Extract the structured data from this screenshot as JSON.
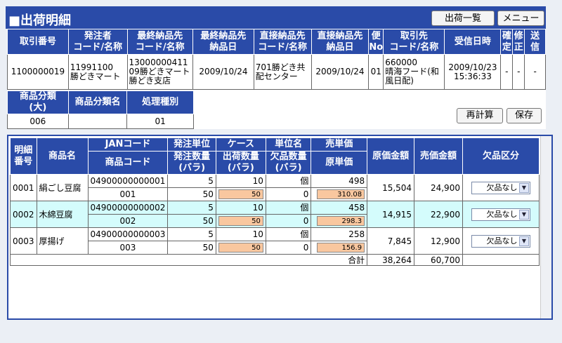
{
  "header": {
    "title": "■出荷明細",
    "buttons": {
      "shipment_list": "出荷一覧",
      "menu": "メニュー"
    }
  },
  "order_table": {
    "headers": [
      [
        "取引番号"
      ],
      [
        "発注者",
        "コード/名称"
      ],
      [
        "最終納品先",
        "コード/名称"
      ],
      [
        "最終納品先",
        "納品日"
      ],
      [
        "直接納品先",
        "コード/名称"
      ],
      [
        "直接納品先",
        "納品日"
      ],
      [
        "便",
        "No"
      ],
      [
        "取引先",
        "コード/名称"
      ],
      [
        "受信日時"
      ],
      [
        "確",
        "定"
      ],
      [
        "修",
        "正"
      ],
      [
        "送",
        "信"
      ]
    ],
    "row": {
      "transaction_no": "1100000019",
      "orderer_code": "11991100",
      "orderer_name": "勝どきマート",
      "final_dest": "1300000041109勝どきマート勝どき支店",
      "final_date": "2009/10/24",
      "direct_dest": "701勝どき共配センター",
      "direct_date": "2009/10/24",
      "bin_no": "01",
      "supplier_code": "660000",
      "supplier_name": "晴海フード(和風日配)",
      "received_date": "2009/10/23",
      "received_time": "15:36:33",
      "confirmed": "-",
      "modified": "-",
      "sent": "-"
    }
  },
  "category_table": {
    "headers": {
      "major": [
        "商品分類",
        "(大)"
      ],
      "name": "商品分類名",
      "process": "処理種別"
    },
    "values": {
      "major": "006",
      "name": "",
      "process": "01"
    }
  },
  "actions": {
    "recalc": "再計算",
    "save": "保存"
  },
  "detail_table": {
    "headers": {
      "line_no": [
        "明細",
        "番号"
      ],
      "product_name": "商品名",
      "jan": "JANコード",
      "product_code": "商品コード",
      "order_unit": "発注単位",
      "order_qty": [
        "発注数量",
        "(バラ)"
      ],
      "case": "ケース",
      "ship_qty": [
        "出荷数量",
        "(バラ)"
      ],
      "unit_name": "単位名",
      "short_qty": [
        "欠品数量",
        "(バラ)"
      ],
      "selling_price": "売単価",
      "cost_price": "原単価",
      "cost_amount": "原価金額",
      "sales_amount": "売価金額",
      "shortage_type": "欠品区分"
    },
    "rows": [
      {
        "line_no": "0001",
        "name": "絹ごし豆腐",
        "jan": "04900000000001",
        "code": "001",
        "order_unit": "5",
        "order_qty": "50",
        "case": "10",
        "ship_qty": "50",
        "unit_name": "個",
        "short_qty": "0",
        "selling_price": "498",
        "cost_price": "310.08",
        "cost_amount": "15,504",
        "sales_amount": "24,900",
        "shortage": "欠品なし"
      },
      {
        "line_no": "0002",
        "name": "木綿豆腐",
        "jan": "04900000000002",
        "code": "002",
        "order_unit": "5",
        "order_qty": "50",
        "case": "10",
        "ship_qty": "50",
        "unit_name": "個",
        "short_qty": "0",
        "selling_price": "458",
        "cost_price": "298.3",
        "cost_amount": "14,915",
        "sales_amount": "22,900",
        "shortage": "欠品なし"
      },
      {
        "line_no": "0003",
        "name": "厚揚げ",
        "jan": "04900000000003",
        "code": "003",
        "order_unit": "5",
        "order_qty": "50",
        "case": "10",
        "ship_qty": "50",
        "unit_name": "個",
        "short_qty": "0",
        "selling_price": "258",
        "cost_price": "156.9",
        "cost_amount": "7,845",
        "sales_amount": "12,900",
        "shortage": "欠品なし"
      }
    ],
    "total": {
      "label": "合計",
      "cost_amount": "38,264",
      "sales_amount": "60,700"
    }
  },
  "colors": {
    "header_blue": "#2a4ba8",
    "row_highlight": "#d4fcfc",
    "input_orange": "#f9c79f",
    "page_bg": "#ebeff5"
  }
}
